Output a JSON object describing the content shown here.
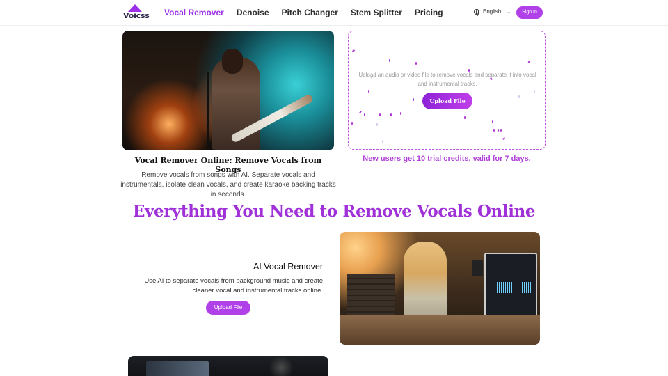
{
  "header": {
    "logo_text": "Voicss",
    "nav": [
      "Vocal Remover",
      "Denoise",
      "Pitch Changer",
      "Stem Splitter",
      "Pricing"
    ],
    "active_nav": "Vocal Remover",
    "language": "English",
    "signin_label": "Sign In"
  },
  "hero": {
    "title": "Vocal Remover Online: Remove Vocals from Songs",
    "description": "Remove vocals from songs with AI. Separate vocals and instrumentals, isolate clean vocals, and create karaoke backing tracks in seconds."
  },
  "upload": {
    "instruction": "Upload an audio or video file to remove vocals and separate it into vocal and instrumental tracks.",
    "button_label": "Upload File",
    "promo": "New users get 10 trial credits, valid for 7 days."
  },
  "section": {
    "title": "Everything You Need to Remove Vocals Online"
  },
  "feature": {
    "title": "AI Vocal Remover",
    "description": "Use AI to separate vocals from background music and create cleaner vocal and instrumental tracks online.",
    "button_label": "Upload File"
  },
  "colors": {
    "accent": "#9b30e8",
    "button": "#b040e8",
    "heading": "#a030d8"
  }
}
